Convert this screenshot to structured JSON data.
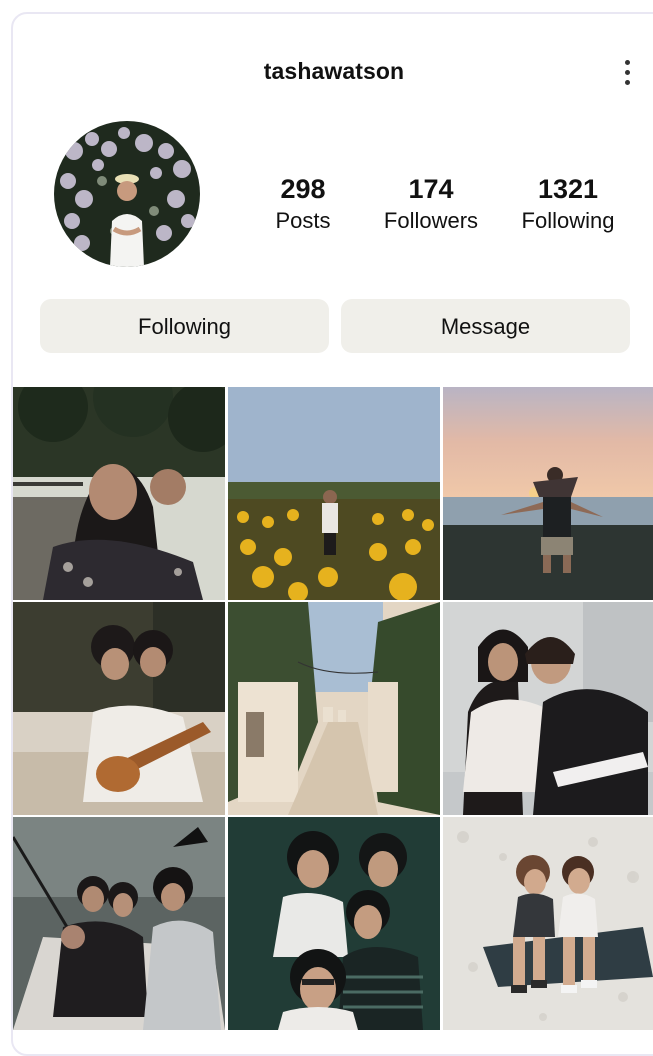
{
  "profile": {
    "username": "tashawatson",
    "avatar_alt": "profile picture"
  },
  "icons": {
    "more": "more-vertical-icon"
  },
  "stats": [
    {
      "value": "298",
      "label": "Posts"
    },
    {
      "value": "174",
      "label": "Followers"
    },
    {
      "value": "1321",
      "label": "Following"
    }
  ],
  "actions": {
    "following_label": "Following",
    "message_label": "Message"
  },
  "colors": {
    "button_bg": "#f0efea",
    "card_border": "#e9e7f3"
  }
}
